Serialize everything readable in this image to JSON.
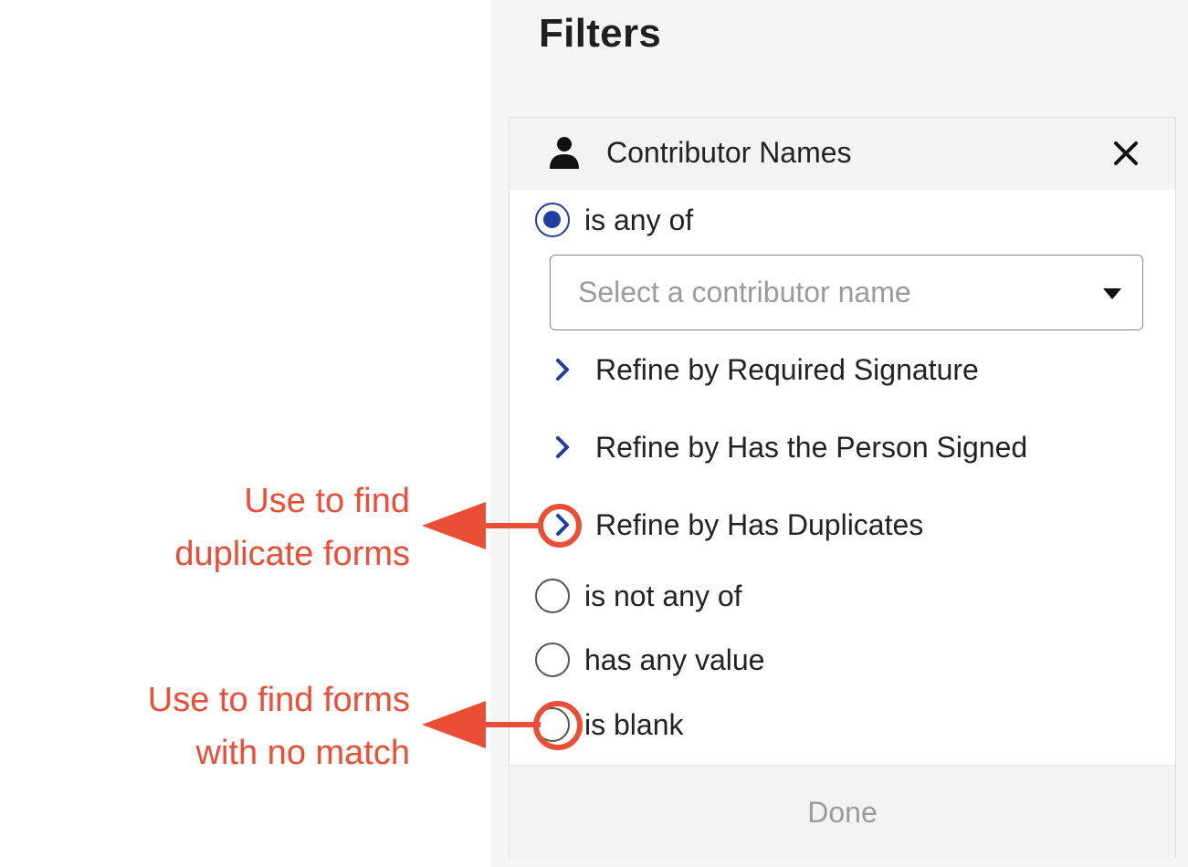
{
  "panel": {
    "title": "Filters",
    "filter_card": {
      "header_title": "Contributor Names",
      "header_icon": "person-icon",
      "close_icon": "close-icon",
      "options": [
        {
          "label": "is any of",
          "selected": true
        },
        {
          "label": "is not any of",
          "selected": false
        },
        {
          "label": "has any value",
          "selected": false
        },
        {
          "label": "is blank",
          "selected": false
        }
      ],
      "select": {
        "placeholder": "Select a contributor name"
      },
      "refinements": [
        {
          "label": "Refine by Required Signature"
        },
        {
          "label": "Refine by Has the Person Signed"
        },
        {
          "label": "Refine by Has Duplicates"
        }
      ],
      "done_label": "Done"
    }
  },
  "annotations": [
    {
      "lines": [
        "Use to find",
        "duplicate forms"
      ]
    },
    {
      "lines": [
        "Use to find forms",
        "with no match"
      ]
    }
  ],
  "colors": {
    "accent": "#1f3e9e",
    "annotation": "#ea4e36",
    "panel_bg": "#f5f5f5",
    "header_bg": "#f3f3f3"
  }
}
